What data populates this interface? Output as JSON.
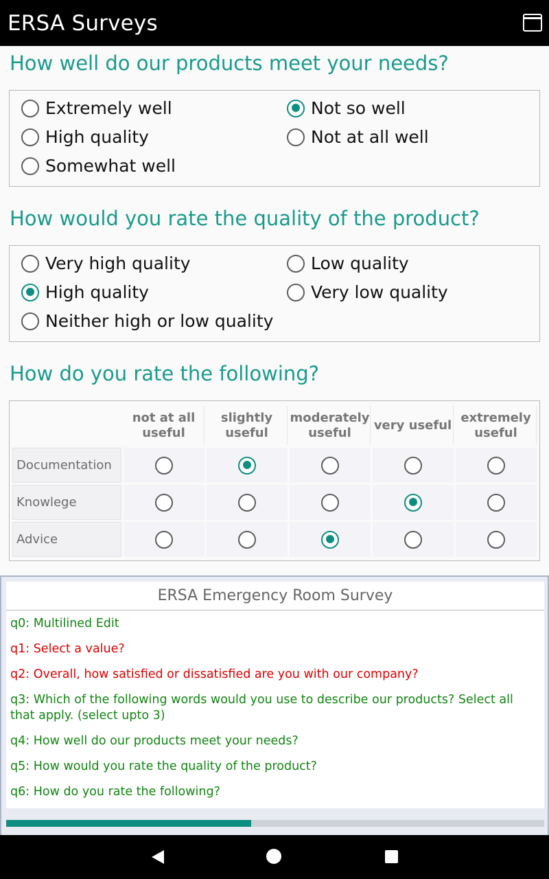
{
  "app": {
    "title": "ERSA Surveys",
    "icon": "window-icon"
  },
  "q4": {
    "title": "How well do our products meet your needs?",
    "options": [
      {
        "label": "Extremely well",
        "checked": false
      },
      {
        "label": "High quality",
        "checked": false
      },
      {
        "label": "Somewhat well",
        "checked": false
      },
      {
        "label": "Not so well",
        "checked": true
      },
      {
        "label": "Not at all well",
        "checked": false
      }
    ]
  },
  "q5": {
    "title": "How would you rate the quality of the product?",
    "options": [
      {
        "label": "Very high quality",
        "checked": false
      },
      {
        "label": "High quality",
        "checked": true
      },
      {
        "label": "Neither high or low quality",
        "checked": false
      },
      {
        "label": "Low quality",
        "checked": false
      },
      {
        "label": "Very low quality",
        "checked": false
      }
    ]
  },
  "q6": {
    "title": "How do you rate the following?",
    "columns": [
      "not at all useful",
      "slightly useful",
      "moderately useful",
      "very useful",
      "extremely useful"
    ],
    "rows": [
      {
        "label": "Documentation",
        "selected": 1
      },
      {
        "label": "Knowlege",
        "selected": 3
      },
      {
        "label": "Advice",
        "selected": 2
      }
    ]
  },
  "panel": {
    "title": "ERSA Emergency Room Survey",
    "items": [
      {
        "text": "q0: Multilined Edit",
        "status": "ok"
      },
      {
        "text": "q1: Select a value?",
        "status": "err"
      },
      {
        "text": "q2: Overall, how satisfied or dissatisfied are you with our company?",
        "status": "err"
      },
      {
        "text": "q3: Which of the following words would you use to describe our products? Select all that apply. (select upto 3)",
        "status": "ok"
      },
      {
        "text": "q4: How well do our products meet your needs?",
        "status": "ok"
      },
      {
        "text": "q5: How would you rate the quality of the product?",
        "status": "ok"
      },
      {
        "text": "q6: How do you rate the following?",
        "status": "ok"
      }
    ],
    "progress": 0.455
  },
  "colors": {
    "accent": "#0e8e80",
    "ok": "#118511",
    "error": "#dd0000",
    "title": "#199b8c"
  },
  "nav": {
    "back": "back-icon",
    "home": "home-icon",
    "recent": "recents-icon"
  }
}
